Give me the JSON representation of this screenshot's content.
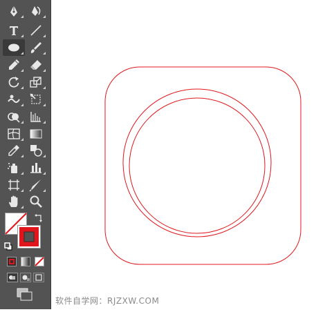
{
  "toolbar": {
    "tools": [
      {
        "id": "pen",
        "icon": "pen-tool-icon"
      },
      {
        "id": "curvature",
        "icon": "curvature-tool-icon"
      },
      {
        "id": "type",
        "icon": "type-tool-icon"
      },
      {
        "id": "line",
        "icon": "line-segment-tool-icon"
      },
      {
        "id": "ellipse",
        "icon": "ellipse-tool-icon",
        "active": true
      },
      {
        "id": "paintbrush",
        "icon": "paintbrush-tool-icon"
      },
      {
        "id": "pencil",
        "icon": "pencil-tool-icon"
      },
      {
        "id": "eraser",
        "icon": "eraser-tool-icon"
      },
      {
        "id": "rotate",
        "icon": "rotate-tool-icon"
      },
      {
        "id": "scale",
        "icon": "scale-tool-icon"
      },
      {
        "id": "warp",
        "icon": "warp-tool-icon"
      },
      {
        "id": "free-transform",
        "icon": "free-transform-tool-icon"
      },
      {
        "id": "shape-builder",
        "icon": "shape-builder-tool-icon"
      },
      {
        "id": "perspective-grid",
        "icon": "perspective-grid-tool-icon"
      },
      {
        "id": "mesh",
        "icon": "mesh-tool-icon"
      },
      {
        "id": "gradient",
        "icon": "gradient-tool-icon"
      },
      {
        "id": "eyedropper",
        "icon": "eyedropper-tool-icon"
      },
      {
        "id": "blend",
        "icon": "blend-tool-icon"
      },
      {
        "id": "symbol-sprayer",
        "icon": "symbol-sprayer-tool-icon"
      },
      {
        "id": "column-graph",
        "icon": "column-graph-tool-icon"
      },
      {
        "id": "artboard",
        "icon": "artboard-tool-icon"
      },
      {
        "id": "slice",
        "icon": "slice-tool-icon"
      },
      {
        "id": "hand",
        "icon": "hand-tool-icon"
      },
      {
        "id": "zoom",
        "icon": "zoom-tool-icon"
      }
    ],
    "fill_stroke": {
      "fill": "none",
      "stroke_color": "#e0161c",
      "swap_icon": "swap-fill-stroke-icon",
      "default_icon": "default-fill-stroke-icon"
    },
    "color_modes": [
      "color-mode-icon",
      "gradient-mode-icon",
      "none-mode-icon"
    ],
    "draw_modes": [
      "draw-normal-icon",
      "draw-behind-icon",
      "draw-inside-icon"
    ],
    "screen_mode_icon": "screen-mode-icon"
  },
  "canvas": {
    "stroke_color": "#e0161c",
    "shapes": [
      "rounded-square",
      "outer-circle",
      "inner-circle"
    ]
  },
  "watermark": "软件自学网：RJZXW.COM"
}
